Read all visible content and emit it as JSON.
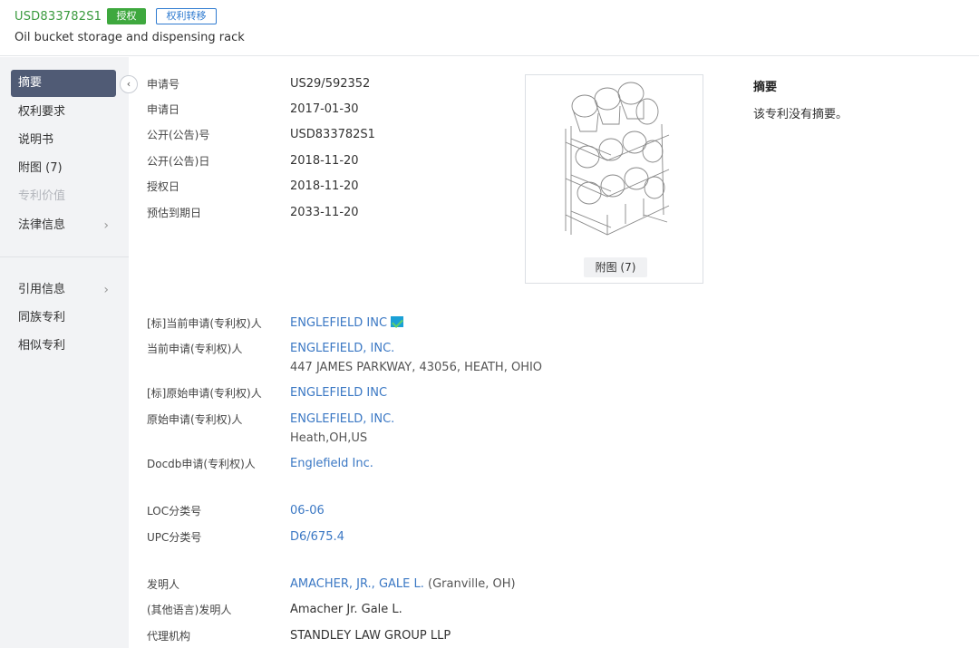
{
  "header": {
    "patent_number": "USD833782S1",
    "badge_granted": "授权",
    "badge_transfer": "权利转移",
    "title": "Oil bucket storage and dispensing rack"
  },
  "sidebar": {
    "collapse_icon": "chevron-left-icon",
    "items": [
      {
        "label": "摘要",
        "state": "active"
      },
      {
        "label": "权利要求",
        "state": "normal"
      },
      {
        "label": "说明书",
        "state": "normal"
      },
      {
        "label": "附图 (7)",
        "state": "normal"
      },
      {
        "label": "专利价值",
        "state": "disabled"
      },
      {
        "label": "法律信息",
        "state": "normal",
        "arrow": "›"
      },
      {
        "label": "引用信息",
        "state": "normal",
        "arrow": "›"
      },
      {
        "label": "同族专利",
        "state": "normal"
      },
      {
        "label": "相似专利",
        "state": "normal"
      }
    ]
  },
  "biblio": [
    {
      "label": "申请号",
      "value": "US29/592352"
    },
    {
      "label": "申请日",
      "value": "2017-01-30"
    },
    {
      "label": "公开(公告)号",
      "value": "USD833782S1"
    },
    {
      "label": "公开(公告)日",
      "value": "2018-11-20"
    },
    {
      "label": "授权日",
      "value": "2018-11-20"
    },
    {
      "label": "预估到期日",
      "value": "2033-11-20"
    }
  ],
  "figure": {
    "caption": "附图 (7)"
  },
  "abstract": {
    "title": "摘要",
    "text": "该专利没有摘要。"
  },
  "parties": {
    "std_current_label": "[标]当前申请(专利权)人",
    "std_current_value": "ENGLEFIELD INC",
    "current_label": "当前申请(专利权)人",
    "current_value": "ENGLEFIELD, INC.",
    "current_address": "447 JAMES PARKWAY, 43056, HEATH, OHIO",
    "std_original_label": "[标]原始申请(专利权)人",
    "std_original_value": "ENGLEFIELD INC",
    "original_label": "原始申请(专利权)人",
    "original_value": "ENGLEFIELD, INC.",
    "original_address": "Heath,OH,US",
    "docdb_label": "Docdb申请(专利权)人",
    "docdb_value": "Englefield Inc."
  },
  "classification": {
    "loc_label": "LOC分类号",
    "loc_value": "06-06",
    "upc_label": "UPC分类号",
    "upc_value": "D6/675.4"
  },
  "people": {
    "inventor_label": "发明人",
    "inventor_value": "AMACHER, JR., GALE L.",
    "inventor_location": "(Granville, OH)",
    "other_lang_inventor_label": "(其他语言)发明人",
    "other_lang_inventor_value": "Amacher Jr. Gale L.",
    "agency_label": "代理机构",
    "agency_value": "STANDLEY LAW GROUP LLP"
  }
}
